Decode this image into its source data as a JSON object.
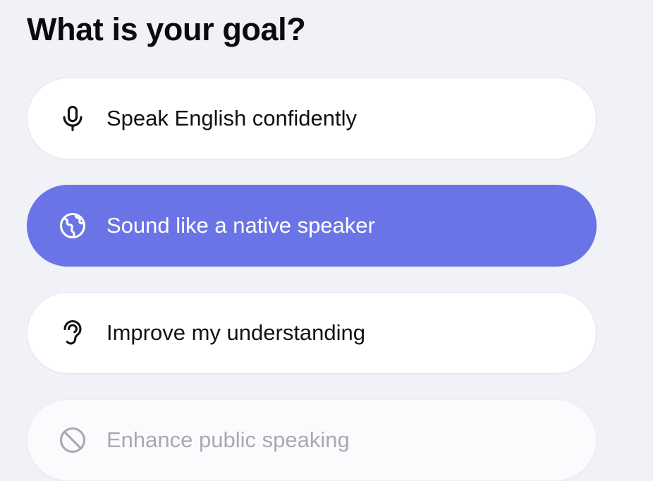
{
  "page": {
    "title": "What is your goal?"
  },
  "colors": {
    "background": "#f1f2f7",
    "card": "#ffffff",
    "selected": "#6b74e6",
    "text": "#121214",
    "muted_text": "#a9a9b0"
  },
  "options": [
    {
      "label": "Speak English confidently",
      "icon": "microphone-icon",
      "selected": false
    },
    {
      "label": "Sound like a native speaker",
      "icon": "globe-icon",
      "selected": true
    },
    {
      "label": "Improve my understanding",
      "icon": "ear-icon",
      "selected": false
    },
    {
      "label": "Enhance public speaking",
      "icon": "microphone-off-icon",
      "selected": false
    }
  ]
}
